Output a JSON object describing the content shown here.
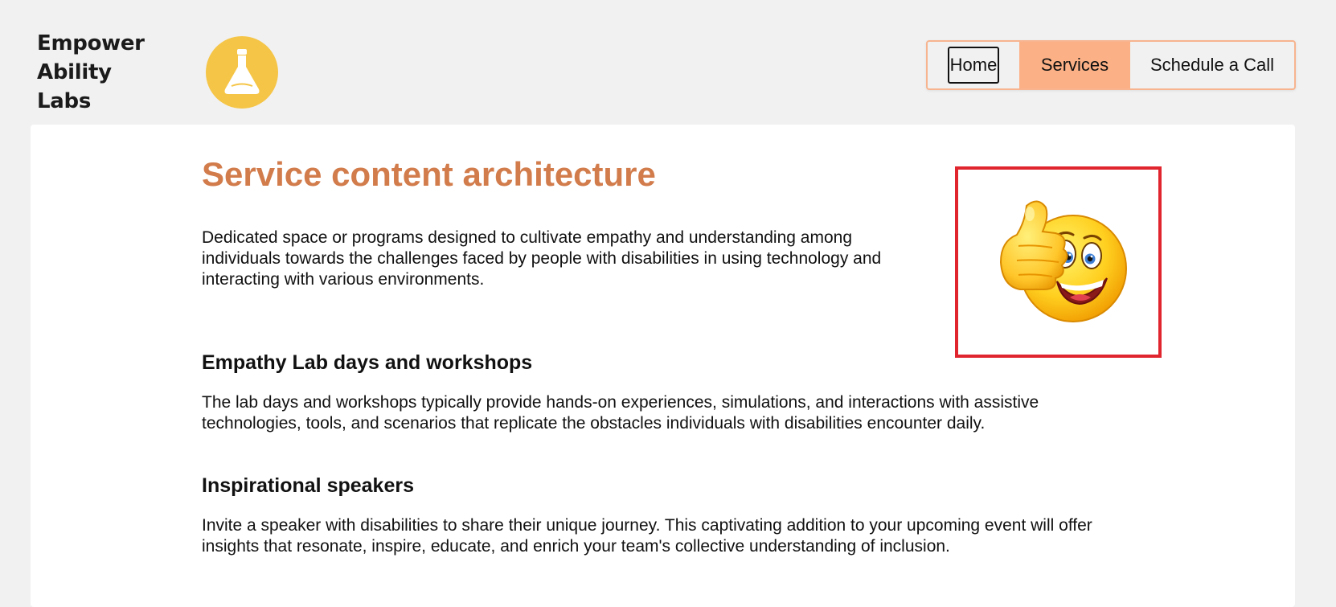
{
  "brand": {
    "name_line1": "Empower Ability",
    "name_line2": "Labs",
    "logo_icon": "flask-icon",
    "logo_color": "#f5c547"
  },
  "nav": {
    "items": [
      {
        "label": "Home",
        "state": "focused"
      },
      {
        "label": "Services",
        "state": "active"
      },
      {
        "label": "Schedule a Call",
        "state": "default"
      }
    ],
    "active_color": "#fbb086",
    "border_color": "#f7b48f"
  },
  "main": {
    "title": "Service content architecture",
    "title_color": "#d27c4c",
    "intro": "Dedicated space or programs designed to cultivate empathy and understanding among individuals towards the challenges faced by people with disabilities in using technology and interacting with various environments.",
    "image_icon": "thumbs-up-smiley-icon",
    "image_border_color": "#e0252f",
    "sections": [
      {
        "heading": "Empathy Lab days and workshops",
        "body": "The lab days and workshops typically provide hands-on experiences, simulations, and interactions with assistive technologies, tools, and scenarios that replicate the obstacles individuals with disabilities encounter daily."
      },
      {
        "heading": "Inspirational speakers",
        "body": "Invite a speaker with disabilities to share their unique journey. This captivating addition to your upcoming event will offer insights that resonate, inspire, educate, and enrich your team's collective understanding of inclusion."
      }
    ]
  }
}
